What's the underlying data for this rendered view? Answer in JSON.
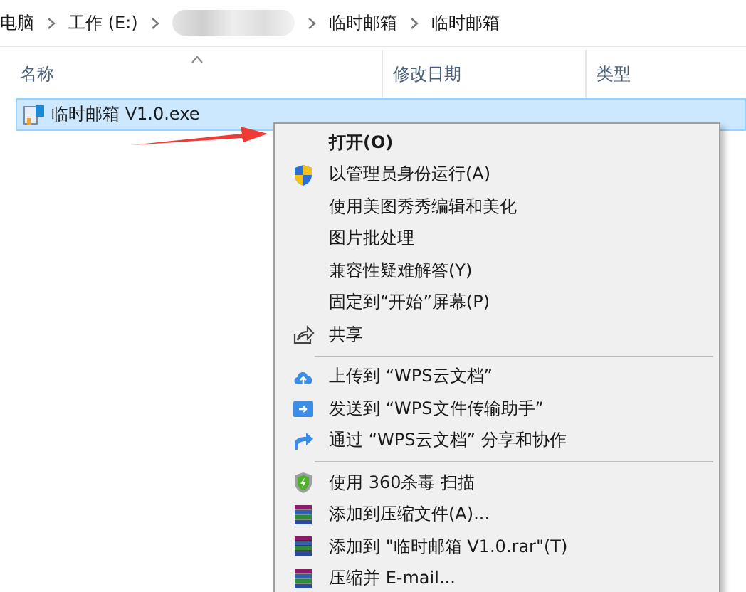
{
  "breadcrumb": [
    {
      "kind": "text",
      "label": "电脑"
    },
    {
      "kind": "text",
      "label": "工作 (E:)"
    },
    {
      "kind": "blurred"
    },
    {
      "kind": "text",
      "label": "临时邮箱"
    },
    {
      "kind": "text",
      "label": "临时邮箱"
    }
  ],
  "columns": [
    {
      "label": "名称",
      "sorted": true
    },
    {
      "label": "修改日期",
      "sorted": false
    },
    {
      "label": "类型",
      "sorted": false
    }
  ],
  "files": [
    {
      "name": "临时邮箱 V1.0.exe",
      "selected": true
    }
  ],
  "context_menu": [
    {
      "kind": "plain",
      "label": "打开(O)",
      "default": true
    },
    {
      "kind": "shield",
      "label": "以管理员身份运行(A)",
      "default": false
    },
    {
      "kind": "plain",
      "label": "使用美图秀秀编辑和美化",
      "default": false
    },
    {
      "kind": "plain",
      "label": "图片批处理",
      "default": false
    },
    {
      "kind": "plain",
      "label": "兼容性疑难解答(Y)",
      "default": false
    },
    {
      "kind": "plain",
      "label": "固定到“开始”屏幕(P)",
      "default": false
    },
    {
      "kind": "share",
      "label": "共享",
      "default": false
    },
    {
      "kind": "separator"
    },
    {
      "kind": "cloud",
      "label": "上传到 “WPS云文档”",
      "default": false
    },
    {
      "kind": "send",
      "label": "发送到 “WPS文件传输助手”",
      "default": false
    },
    {
      "kind": "collab",
      "label": "通过 “WPS云文档” 分享和协作",
      "default": false
    },
    {
      "kind": "separator"
    },
    {
      "kind": "antivirus",
      "label": "使用 360杀毒 扫描",
      "default": false
    },
    {
      "kind": "archive",
      "label": "添加到压缩文件(A)...",
      "default": false
    },
    {
      "kind": "archive",
      "label": "添加到 \"临时邮箱 V1.0.rar\"(T)",
      "default": false
    },
    {
      "kind": "archive",
      "label": "压缩并 E-mail...",
      "default": false
    }
  ]
}
